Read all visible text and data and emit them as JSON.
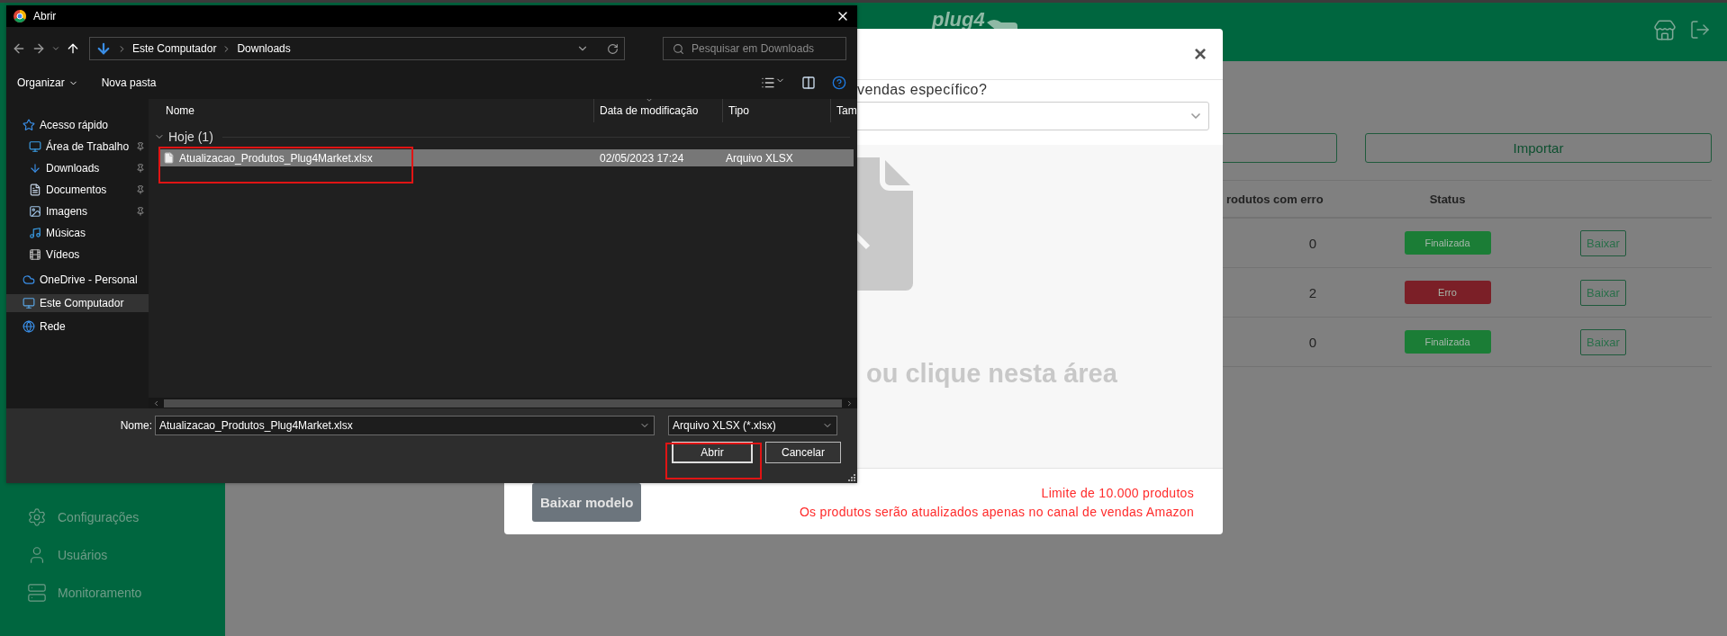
{
  "app": {
    "logo": "plug4",
    "sidebar": {
      "items": [
        {
          "label": "Configurações",
          "kind": "settings"
        },
        {
          "label": "Usuários",
          "kind": "user"
        },
        {
          "label": "Monitoramento",
          "kind": "monitor"
        }
      ]
    },
    "import_button": "Importar",
    "table": {
      "columns": [
        "rodutos com erro",
        "Status"
      ],
      "rows": [
        {
          "errors": "0",
          "status": "Finalizada",
          "color": "#1b7d36",
          "action": "Baixar"
        },
        {
          "errors": "2",
          "status": "Erro",
          "color": "#7b1f27",
          "action": "Baixar"
        },
        {
          "errors": "0",
          "status": "Finalizada",
          "color": "#1b7d36",
          "action": "Baixar"
        }
      ]
    }
  },
  "modal": {
    "close": "×",
    "question": "vendas específico?",
    "dropzone_text": "ou clique nesta área",
    "download_button": "Baixar modelo",
    "notes": [
      "Limite de 10.000 produtos",
      "Os produtos serão atualizados apenas no canal de vendas Amazon"
    ]
  },
  "file_dialog": {
    "title": "Abrir",
    "path": [
      "Este Computador",
      "Downloads"
    ],
    "search_placeholder": "Pesquisar em Downloads",
    "toolbar": [
      "Organizar",
      "Nova pasta"
    ],
    "nav": [
      {
        "label": "Acesso rápido",
        "kind": "star",
        "pinned": false,
        "selected": false
      },
      {
        "label": "Área de Trabalho",
        "kind": "desktop",
        "pinned": true,
        "selected": false
      },
      {
        "label": "Downloads",
        "kind": "download",
        "pinned": true,
        "selected": false
      },
      {
        "label": "Documentos",
        "kind": "document",
        "pinned": true,
        "selected": false
      },
      {
        "label": "Imagens",
        "kind": "image",
        "pinned": true,
        "selected": false
      },
      {
        "label": "Músicas",
        "kind": "music",
        "pinned": false,
        "selected": false
      },
      {
        "label": "Vídeos",
        "kind": "video",
        "pinned": false,
        "selected": false
      },
      {
        "label": "OneDrive - Personal",
        "kind": "cloud",
        "pinned": false,
        "selected": false
      },
      {
        "label": "Este Computador",
        "kind": "computer",
        "pinned": false,
        "selected": true
      },
      {
        "label": "Rede",
        "kind": "network",
        "pinned": false,
        "selected": false
      }
    ],
    "columns": [
      "Nome",
      "Data de modificação",
      "Tipo",
      "Tam"
    ],
    "group": "Hoje (1)",
    "files": [
      {
        "name": "Atualizacao_Produtos_Plug4Market.xlsx",
        "modified": "02/05/2023 17:24",
        "type": "Arquivo XLSX",
        "selected": true
      }
    ],
    "filename_label": "Nome:",
    "filename": "Atualizacao_Produtos_Plug4Market.xlsx",
    "filetype": "Arquivo XLSX (*.xlsx)",
    "buttons": [
      "Abrir",
      "Cancelar"
    ]
  }
}
